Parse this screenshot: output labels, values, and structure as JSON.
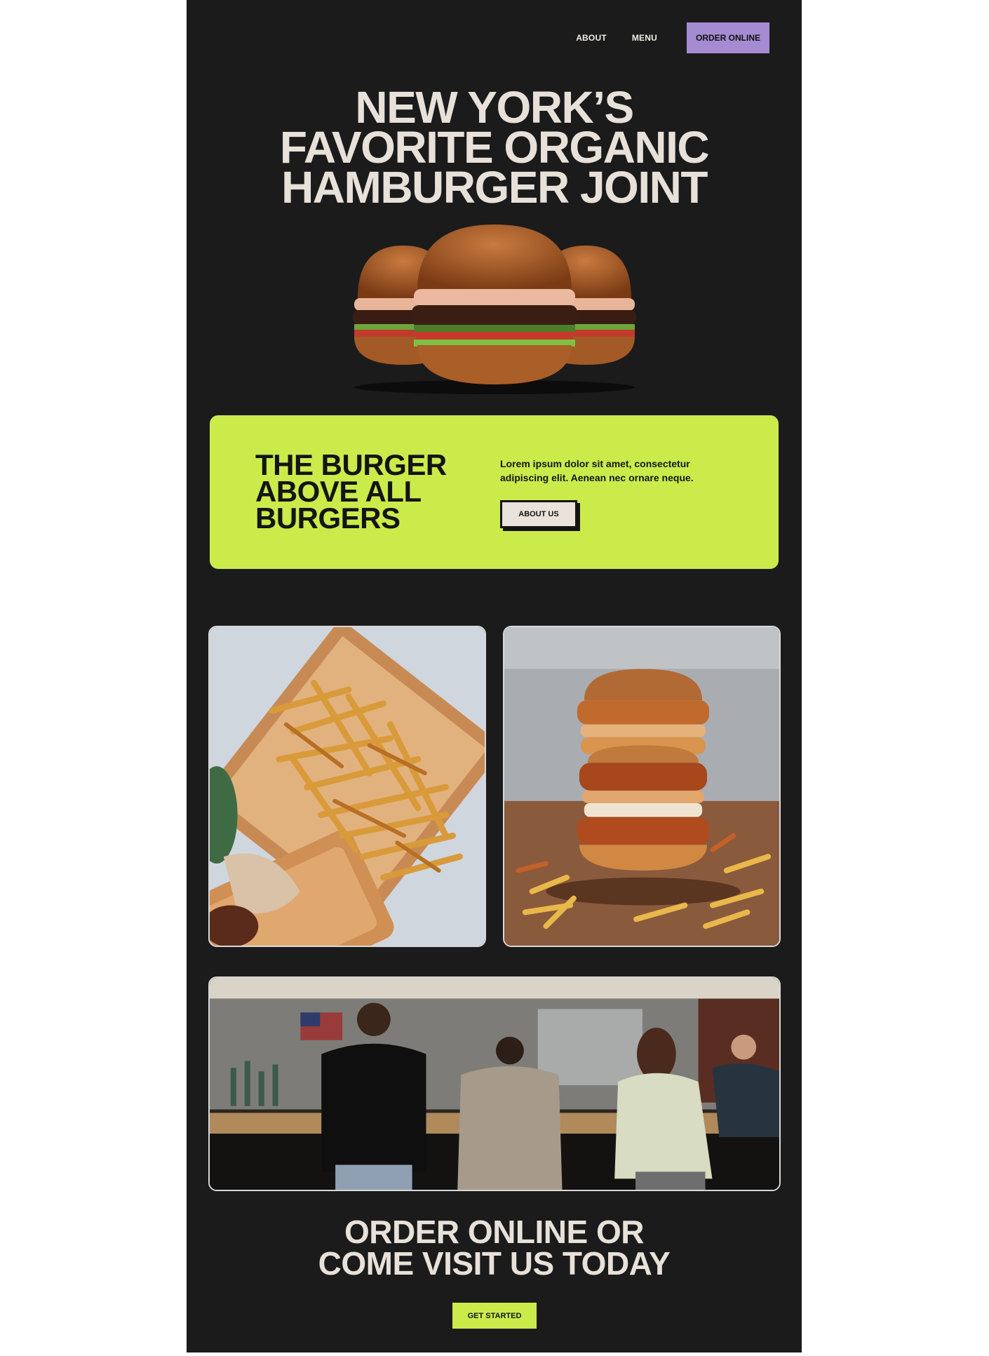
{
  "nav": {
    "about_label": "About",
    "menu_label": "Menu",
    "order_label": "Order Online"
  },
  "hero": {
    "title_line1": "New York’s",
    "title_line2": "Favorite Organic",
    "title_line3": "Hamburger Joint"
  },
  "feature": {
    "title_line1": "The Burger",
    "title_line2": "Above All",
    "title_line3": "Burgers",
    "body": "Lorem ipsum dolor sit amet, consectetur adipiscing elit. Aenean nec ornare neque.",
    "button_label": "About Us"
  },
  "cta": {
    "title_line1": "Order Online or",
    "title_line2": "Come Visit Us Today",
    "button_label": "Get Started"
  },
  "colors": {
    "page_bg": "#1b1b1b",
    "accent_green": "#cbeb4b",
    "accent_purple": "#a48bd2",
    "text_cream": "#e8e1d9"
  },
  "images": {
    "hero": "three-burgers-image",
    "fries": "fries-tray-photo",
    "stack": "stacked-chicken-burger-photo",
    "bar": "restaurant-counter-photo"
  }
}
